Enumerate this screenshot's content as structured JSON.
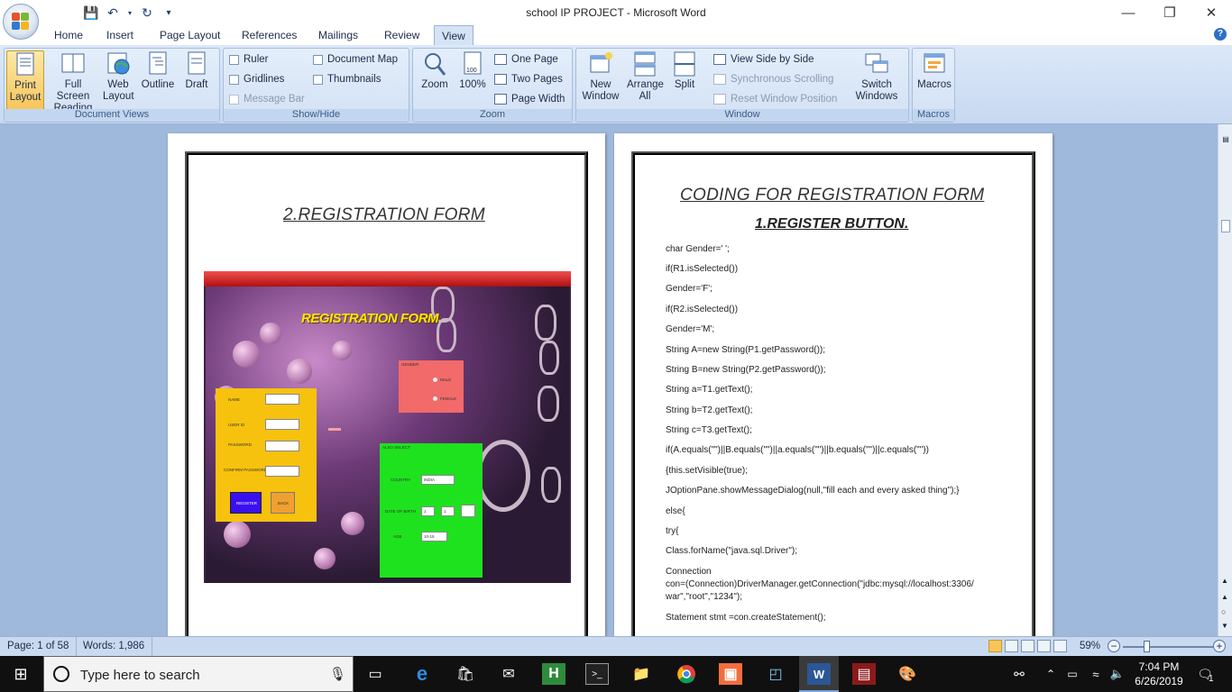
{
  "window": {
    "title": "school IP PROJECT - Microsoft Word"
  },
  "qat": {
    "save_icon": "save-icon",
    "undo_icon": "undo-icon",
    "redo_icon": "redo-icon"
  },
  "tabs": [
    "Home",
    "Insert",
    "Page Layout",
    "References",
    "Mailings",
    "Review",
    "View"
  ],
  "active_tab": "View",
  "ribbon": {
    "document_views": {
      "label": "Document Views",
      "print_layout": "Print Layout",
      "full_screen_reading": "Full Screen Reading",
      "web_layout": "Web Layout",
      "outline": "Outline",
      "draft": "Draft"
    },
    "show_hide": {
      "label": "Show/Hide",
      "ruler": "Ruler",
      "gridlines": "Gridlines",
      "message_bar": "Message Bar",
      "document_map": "Document Map",
      "thumbnails": "Thumbnails"
    },
    "zoom": {
      "label": "Zoom",
      "zoom": "Zoom",
      "hundred": "100%",
      "one_page": "One Page",
      "two_pages": "Two Pages",
      "page_width": "Page Width"
    },
    "window": {
      "label": "Window",
      "new_window": "New Window",
      "arrange_all": "Arrange All",
      "split": "Split",
      "view_side_by_side": "View Side by Side",
      "synchronous_scrolling": "Synchronous Scrolling",
      "reset_window_position": "Reset Window Position",
      "switch_windows": "Switch Windows"
    },
    "macros": {
      "label": "Macros",
      "macros": "Macros"
    }
  },
  "page1": {
    "heading": "2.REGISTRATION FORM",
    "form": {
      "title": "REGISTRATION FORM",
      "name": "NAME",
      "user_id": "USER ID",
      "password": "PASSWORD",
      "confirm_password": "CONFIRM PASSWORD",
      "register": "REGISTER",
      "back": "BACK",
      "gender": "GENDER",
      "male": "MALE",
      "female": "FEMALE",
      "also_select": "ALSO SELECT",
      "country": "COUNTRY",
      "country_value": "INDIA",
      "dob": "DATE OF BIRTH",
      "dob_day": "1",
      "dob_month": "1",
      "age": "AGE",
      "age_value": "10-15"
    }
  },
  "page2": {
    "heading": "CODING FOR REGISTRATION FORM",
    "subheading": "1.REGISTER BUTTON.",
    "code": [
      "char Gender=' ';",
      "if(R1.isSelected())",
      "Gender='F';",
      "if(R2.isSelected())",
      "Gender='M';",
      "String A=new String(P1.getPassword());",
      "String B=new String(P2.getPassword());",
      "String a=T1.getText();",
      "String b=T2.getText();",
      "String c=T3.getText();",
      "if(A.equals(\"\")||B.equals(\"\")||a.equals(\"\")||b.equals(\"\")||c.equals(\"\"))",
      "{this.setVisible(true);",
      "JOptionPane.showMessageDialog(null,\"fill each and every asked thing\");}",
      "else{",
      "try{",
      "Class.forName(\"java.sql.Driver\");",
      "Connection",
      "con=(Connection)DriverManager.getConnection(\"jdbc:mysql://localhost:3306/",
      "war\",\"root\",\"1234\");",
      "Statement stmt =con.createStatement();"
    ]
  },
  "status": {
    "page": "Page: 1 of 58",
    "words": "Words: 1,986",
    "zoom": "59%"
  },
  "taskbar": {
    "search_placeholder": "Type here to search",
    "time": "7:04 PM",
    "date": "6/26/2019",
    "notification_count": "1"
  }
}
